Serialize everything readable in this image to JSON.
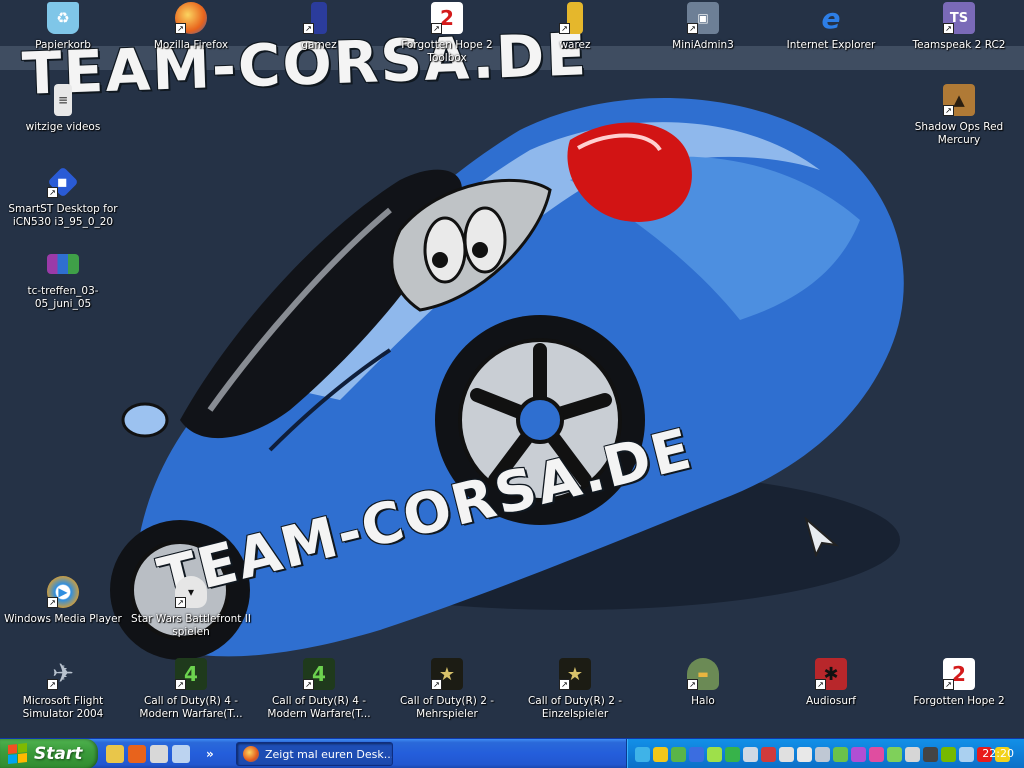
{
  "wallpaper": {
    "title_top": "TEAM-CORSA.DE",
    "title_bottom": "TEAM-CORSA.DE"
  },
  "desktop_icons": [
    {
      "label": "Papierkorb",
      "icon": "recycle-bin-icon",
      "shortcut": false,
      "color": "#7fc6e8"
    },
    {
      "label": "Mozilla Firefox",
      "icon": "firefox-icon",
      "shortcut": true,
      "color": "#e8631c"
    },
    {
      "label": "gamez",
      "icon": "folder-blue-icon",
      "shortcut": true,
      "color": "#2b3c9c"
    },
    {
      "label": "Forgotten Hope 2 Toolbox",
      "icon": "forgotten-hope-icon",
      "shortcut": true,
      "color": "#d41b1b"
    },
    {
      "label": "warez",
      "icon": "folder-yellow-icon",
      "shortcut": true,
      "color": "#e5b72c"
    },
    {
      "label": "MiniAdmin3",
      "icon": "computer-icon",
      "shortcut": true,
      "color": "#6d7f96"
    },
    {
      "label": "Internet Explorer",
      "icon": "internet-explorer-icon",
      "shortcut": false,
      "color": "#2d7ee6"
    },
    {
      "label": "Teamspeak 2 RC2",
      "icon": "teamspeak-icon",
      "shortcut": true,
      "color": "#7a6ab8"
    },
    {
      "label": "witzige videos",
      "icon": "text-file-icon",
      "shortcut": false,
      "color": "#e8e8e8"
    },
    {
      "label": "Shadow Ops  Red Mercury",
      "icon": "shadow-ops-icon",
      "shortcut": true,
      "color": "#b07a36"
    },
    {
      "label": "SmartST Desktop for iCN530 i3_95_0_20",
      "icon": "smartst-icon",
      "shortcut": true,
      "color": "#2a5bd6"
    },
    {
      "label": "tc-treffen_03-05_juni_05",
      "icon": "winrar-archive-icon",
      "shortcut": false,
      "color": "#9b3aa8"
    },
    {
      "label": "Windows Media Player",
      "icon": "media-player-icon",
      "shortcut": true,
      "color": "#2f8ee0"
    },
    {
      "label": "Star Wars Battlefront II spielen",
      "icon": "stormtrooper-icon",
      "shortcut": true,
      "color": "#e6e6e6"
    },
    {
      "label": "Microsoft Flight Simulator 2004",
      "icon": "airplane-icon",
      "shortcut": true,
      "color": "#8b97a6"
    },
    {
      "label": "Call of Duty(R) 4 - Modern Warfare(T...",
      "icon": "cod4-icon",
      "shortcut": true,
      "color": "#3f8f3a"
    },
    {
      "label": "Call of Duty(R) 4 - Modern Warfare(T...",
      "icon": "cod4-icon",
      "shortcut": true,
      "color": "#3f8f3a"
    },
    {
      "label": "Call of Duty(R) 2 - Mehrspieler",
      "icon": "cod2-icon",
      "shortcut": true,
      "color": "#8c7a2c"
    },
    {
      "label": "Call of Duty(R) 2 - Einzelspieler",
      "icon": "cod2-icon",
      "shortcut": true,
      "color": "#8c7a2c"
    },
    {
      "label": "Halo",
      "icon": "halo-icon",
      "shortcut": true,
      "color": "#6b8a55"
    },
    {
      "label": "Audiosurf",
      "icon": "audiosurf-icon",
      "shortcut": true,
      "color": "#b8272b"
    },
    {
      "label": "Forgotten Hope 2",
      "icon": "forgotten-hope-icon",
      "shortcut": true,
      "color": "#d41b1b"
    }
  ],
  "taskbar": {
    "start_label": "Start",
    "quick_launch": [
      {
        "icon": "show-desktop-folder-icon",
        "color": "#e9c64a"
      },
      {
        "icon": "firefox-icon",
        "color": "#e8631c"
      },
      {
        "icon": "media-icon",
        "color": "#d8d8d8"
      },
      {
        "icon": "window-switch-icon",
        "color": "#bcd3f0"
      }
    ],
    "more_label": "»",
    "task_button_label": "Zeigt mal euren Desk...",
    "tray_icons": [
      {
        "icon": "network-icon",
        "color": "#3fb3e8"
      },
      {
        "icon": "security-shield-icon",
        "color": "#f2c71a"
      },
      {
        "icon": "messenger-icon",
        "color": "#5ab548"
      },
      {
        "icon": "bluetooth-icon",
        "color": "#3b6de0"
      },
      {
        "icon": "chat-icon",
        "color": "#9ee04a"
      },
      {
        "icon": "clover-icon",
        "color": "#37b34a"
      },
      {
        "icon": "remove-hardware-icon",
        "color": "#cfd8e4"
      },
      {
        "icon": "antivirus-icon",
        "color": "#d03b3b"
      },
      {
        "icon": "monitor-icon",
        "color": "#e0e0e0"
      },
      {
        "icon": "display-icon",
        "color": "#e8e8e8"
      },
      {
        "icon": "arrow-icon",
        "color": "#bfc8d4"
      },
      {
        "icon": "user-icon",
        "color": "#6bc24a"
      },
      {
        "icon": "game-icon",
        "color": "#b04fd4"
      },
      {
        "icon": "ball-icon",
        "color": "#e04da0"
      },
      {
        "icon": "update-icon",
        "color": "#7fd05a"
      },
      {
        "icon": "speaker-icon",
        "color": "#d6d6d6"
      },
      {
        "icon": "terminal-icon",
        "color": "#444444"
      },
      {
        "icon": "nvidia-icon",
        "color": "#76b900"
      },
      {
        "icon": "settings-icon",
        "color": "#aad0f0"
      },
      {
        "icon": "ati-icon",
        "color": "#e81b1b"
      },
      {
        "icon": "radar-icon",
        "color": "#f2d21a"
      }
    ],
    "clock": "22:20"
  }
}
